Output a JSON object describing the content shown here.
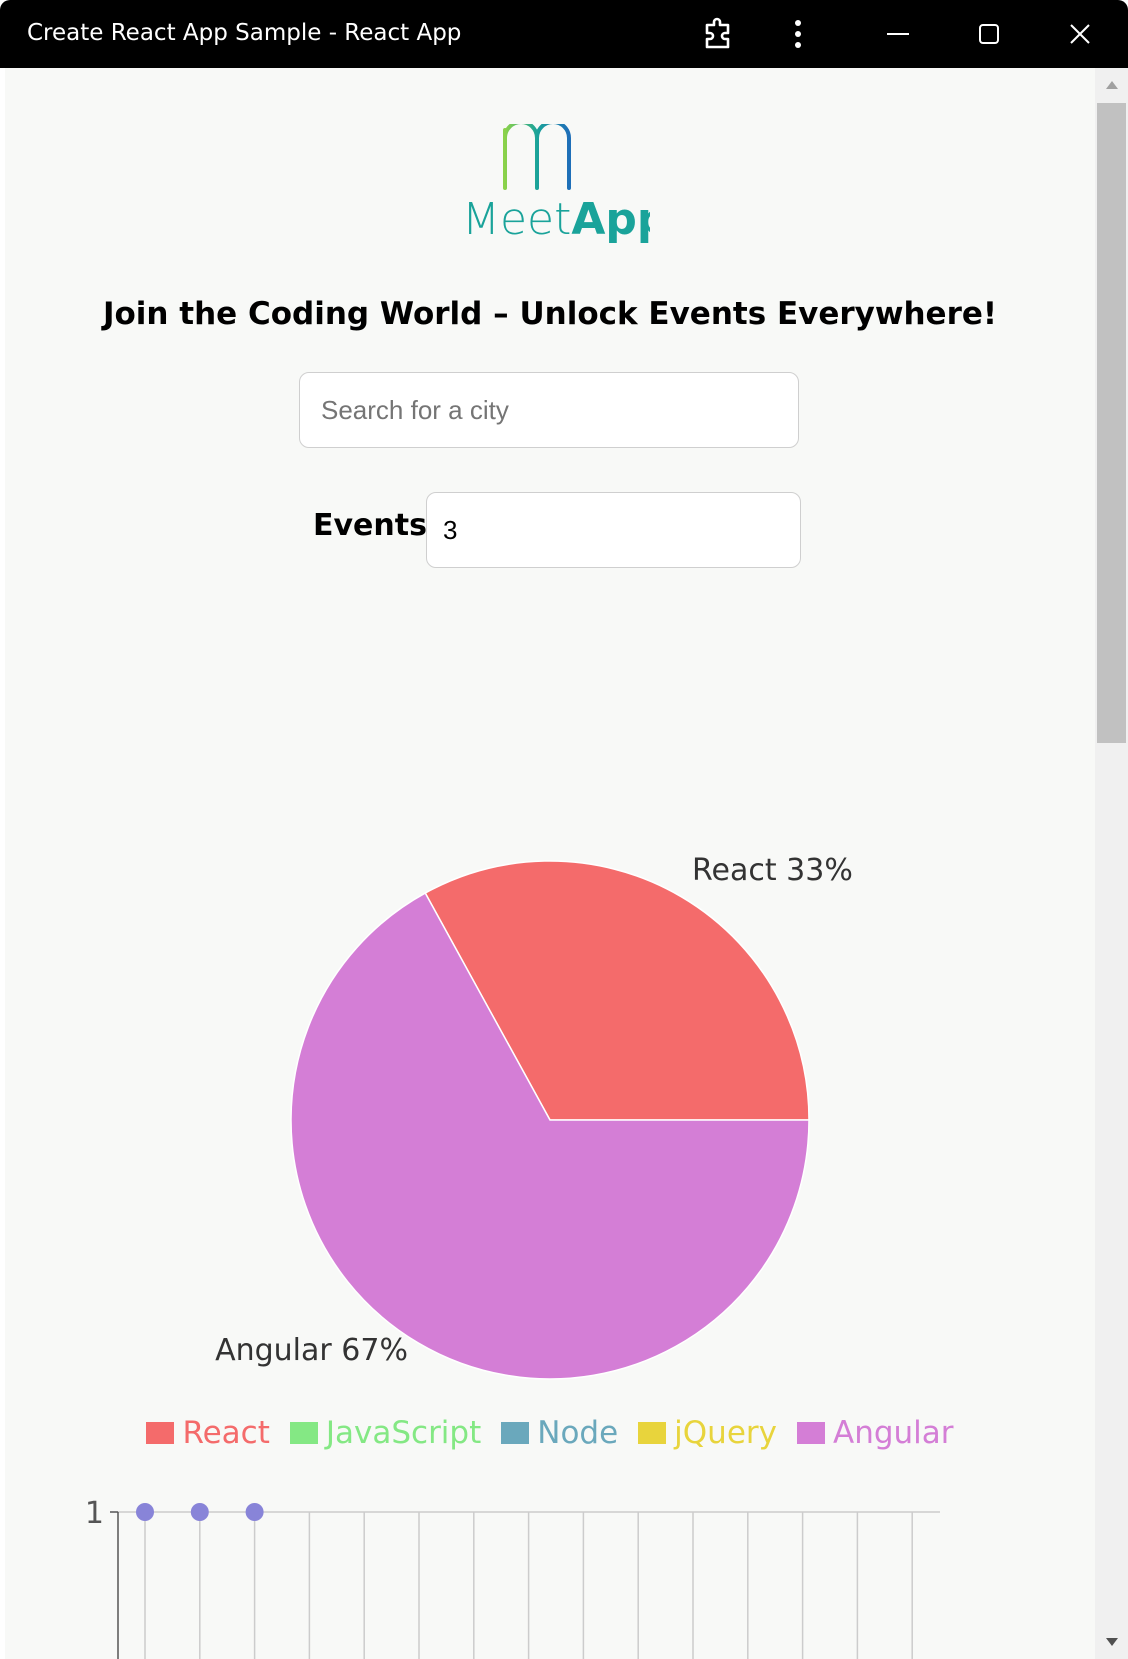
{
  "window": {
    "title": "Create React App Sample - React App"
  },
  "app": {
    "logo": {
      "text_light": "Meet",
      "text_bold": "App",
      "color": "#1aa39a"
    },
    "heading": "Join the Coding World – Unlock Events Everywhere!",
    "city_search": {
      "placeholder": "Search for a city",
      "value": ""
    },
    "events": {
      "label": "Events",
      "value": "3"
    }
  },
  "chart_data": [
    {
      "type": "pie",
      "slices": [
        {
          "name": "React",
          "value": 33,
          "label": "React 33%",
          "color": "#f46b6b"
        },
        {
          "name": "JavaScript",
          "value": 0,
          "color": "#84e884"
        },
        {
          "name": "Node",
          "value": 0,
          "color": "#6aa8bc"
        },
        {
          "name": "jQuery",
          "value": 0,
          "color": "#e8d43c"
        },
        {
          "name": "Angular",
          "value": 67,
          "label": "Angular 67%",
          "color": "#d47ed6"
        }
      ],
      "legend": [
        "React",
        "JavaScript",
        "Node",
        "jQuery",
        "Angular"
      ],
      "legend_placement": "bottom"
    },
    {
      "type": "scatter",
      "y_ticks": [
        "1"
      ],
      "points": [
        {
          "x": 1,
          "y": 1
        },
        {
          "x": 2,
          "y": 1
        },
        {
          "x": 3,
          "y": 1
        }
      ],
      "point_color": "#8884d8",
      "grid": true
    }
  ]
}
